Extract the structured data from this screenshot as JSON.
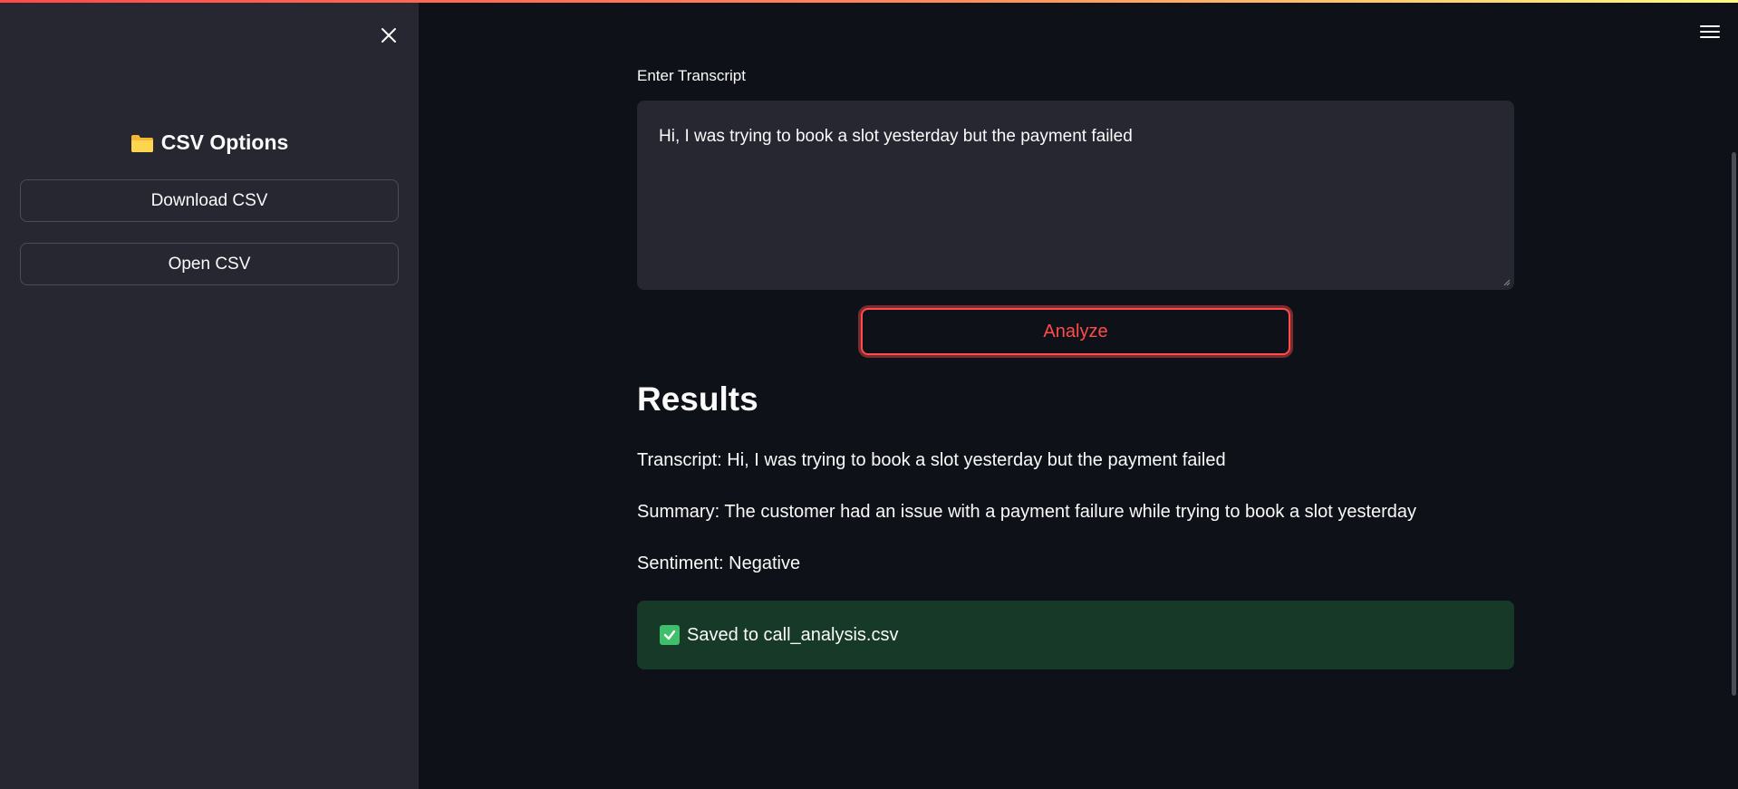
{
  "sidebar": {
    "title": "CSV Options",
    "buttons": {
      "download": "Download CSV",
      "open": "Open CSV"
    }
  },
  "main": {
    "input_label": "Enter Transcript",
    "transcript_value": "Hi, I was trying to book a slot yesterday but the payment failed",
    "analyze_label": "Analyze",
    "results_heading": "Results",
    "results": {
      "transcript": "Transcript: Hi, I was trying to book a slot yesterday but the payment failed",
      "summary": "Summary: The customer had an issue with a payment failure while trying to book a slot yesterday",
      "sentiment": "Sentiment: Negative"
    },
    "success_message": "Saved to call_analysis.csv"
  },
  "colors": {
    "accent": "#ff4b4b",
    "background": "#0e1117",
    "sidebar_bg": "#262730",
    "success_bg": "#173928",
    "success_icon": "#3fbf6a"
  },
  "icons": {
    "close": "close-icon",
    "menu": "hamburger-menu-icon",
    "folder": "folder-icon",
    "check": "check-icon"
  }
}
